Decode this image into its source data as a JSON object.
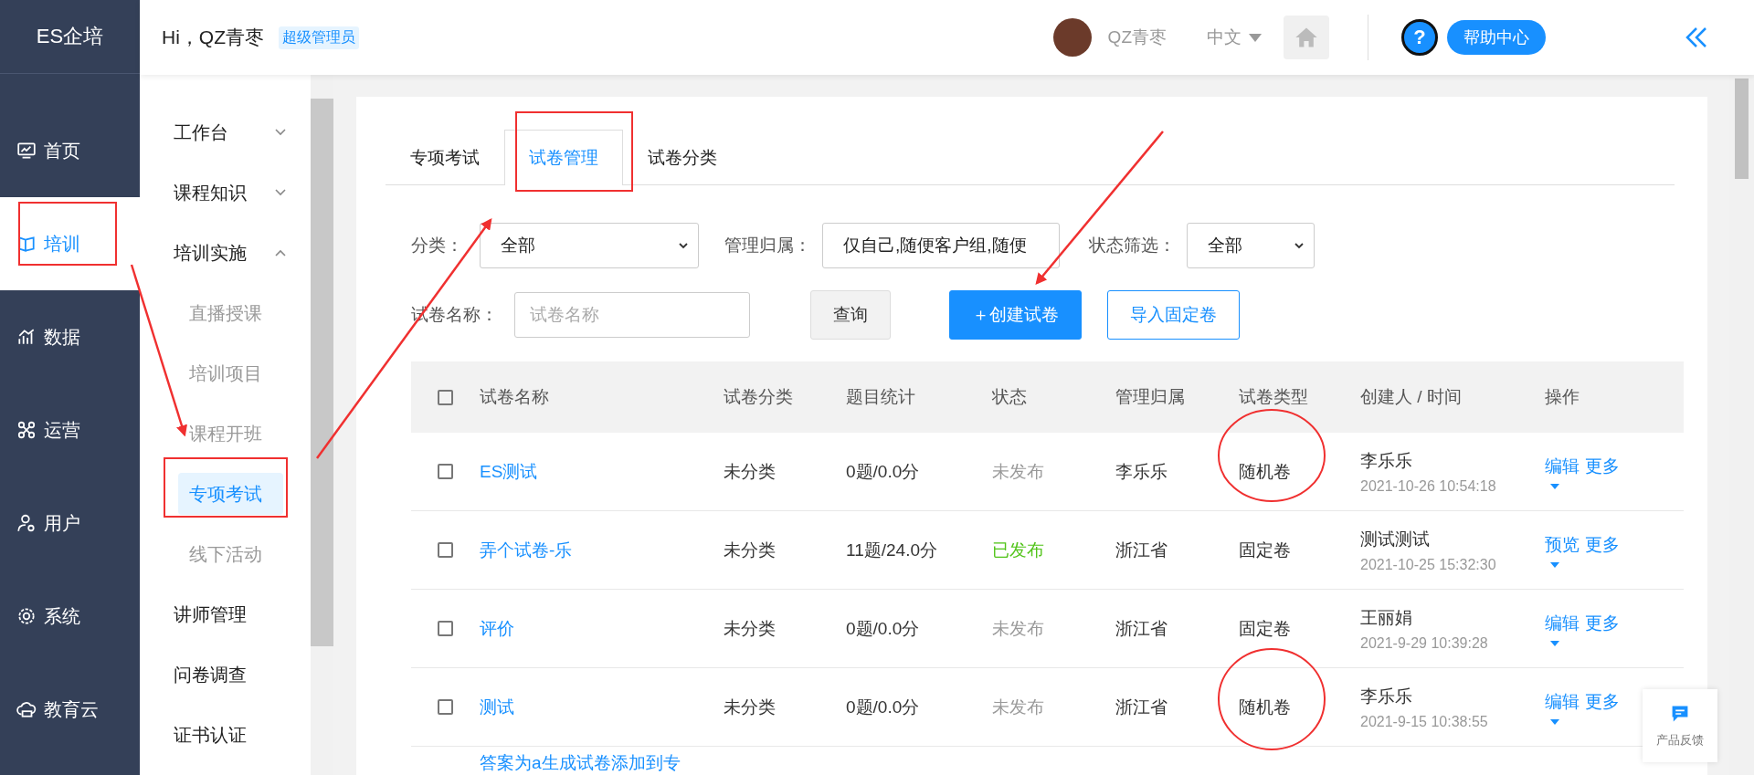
{
  "brand": "ES企培",
  "greeting": {
    "text": "Hi，QZ青枣",
    "role_badge": "超级管理员"
  },
  "user": {
    "name": "QZ青枣"
  },
  "language": "中文",
  "help": "帮助中心",
  "help_mark": "?",
  "main_nav": [
    {
      "label": "首页",
      "selected": false
    },
    {
      "label": "培训",
      "selected": true
    },
    {
      "label": "数据",
      "selected": false
    },
    {
      "label": "运营",
      "selected": false
    },
    {
      "label": "用户",
      "selected": false
    },
    {
      "label": "系统",
      "selected": false
    },
    {
      "label": "教育云",
      "selected": false
    }
  ],
  "sub_nav": [
    {
      "label": "工作台",
      "kind": "group",
      "expanded": false
    },
    {
      "label": "课程知识",
      "kind": "group",
      "expanded": false
    },
    {
      "label": "培训实施",
      "kind": "group",
      "expanded": true,
      "children": [
        {
          "label": "直播授课",
          "selected": false
        },
        {
          "label": "培训项目",
          "selected": false
        },
        {
          "label": "课程开班",
          "selected": false
        },
        {
          "label": "专项考试",
          "selected": true
        },
        {
          "label": "线下活动",
          "selected": false
        }
      ]
    },
    {
      "label": "讲师管理",
      "kind": "link"
    },
    {
      "label": "问卷调查",
      "kind": "link"
    },
    {
      "label": "证书认证",
      "kind": "link"
    }
  ],
  "tabs": [
    {
      "label": "专项考试",
      "selected": false
    },
    {
      "label": "试卷管理",
      "selected": true
    },
    {
      "label": "试卷分类",
      "selected": false
    }
  ],
  "filters": {
    "category": {
      "label": "分类：",
      "value": "全部"
    },
    "ownership": {
      "label": "管理归属：",
      "value": "仅自己,随便客户组,随便"
    },
    "status": {
      "label": "状态筛选：",
      "value": "全部"
    },
    "name": {
      "label": "试卷名称：",
      "placeholder": "试卷名称"
    }
  },
  "buttons": {
    "query": "查询",
    "create": "＋创建试卷",
    "import": "导入固定卷"
  },
  "table": {
    "header_checked": false,
    "columns": [
      "试卷名称",
      "试卷分类",
      "题目统计",
      "状态",
      "管理归属",
      "试卷类型",
      "创建人 / 时间",
      "操作"
    ],
    "rows": [
      {
        "checked": false,
        "name": "ES测试",
        "category": "未分类",
        "stats": "0题/0.0分",
        "status": "未发布",
        "published": false,
        "owner": "李乐乐",
        "type": "随机卷",
        "creator": "李乐乐",
        "time": "2021-10-26 10:54:18",
        "actions": [
          "编辑",
          "更多"
        ]
      },
      {
        "checked": false,
        "name": "弄个试卷-乐",
        "category": "未分类",
        "stats": "11题/24.0分",
        "status": "已发布",
        "published": true,
        "owner": "浙江省",
        "type": "固定卷",
        "creator": "测试测试",
        "time": "2021-10-25 15:32:30",
        "actions": [
          "预览",
          "更多"
        ]
      },
      {
        "checked": false,
        "name": "评价",
        "category": "未分类",
        "stats": "0题/0.0分",
        "status": "未发布",
        "published": false,
        "owner": "浙江省",
        "type": "固定卷",
        "creator": "王丽娟",
        "time": "2021-9-29 10:39:28",
        "actions": [
          "编辑",
          "更多"
        ]
      },
      {
        "checked": false,
        "name": "测试",
        "category": "未分类",
        "stats": "0题/0.0分",
        "status": "未发布",
        "published": false,
        "owner": "浙江省",
        "type": "随机卷",
        "creator": "李乐乐",
        "time": "2021-9-15 10:38:55",
        "actions": [
          "编辑",
          "更多"
        ]
      }
    ],
    "partial_row": {
      "name": "答案为a生成试卷添加到专"
    }
  },
  "feedback": "产品反馈"
}
